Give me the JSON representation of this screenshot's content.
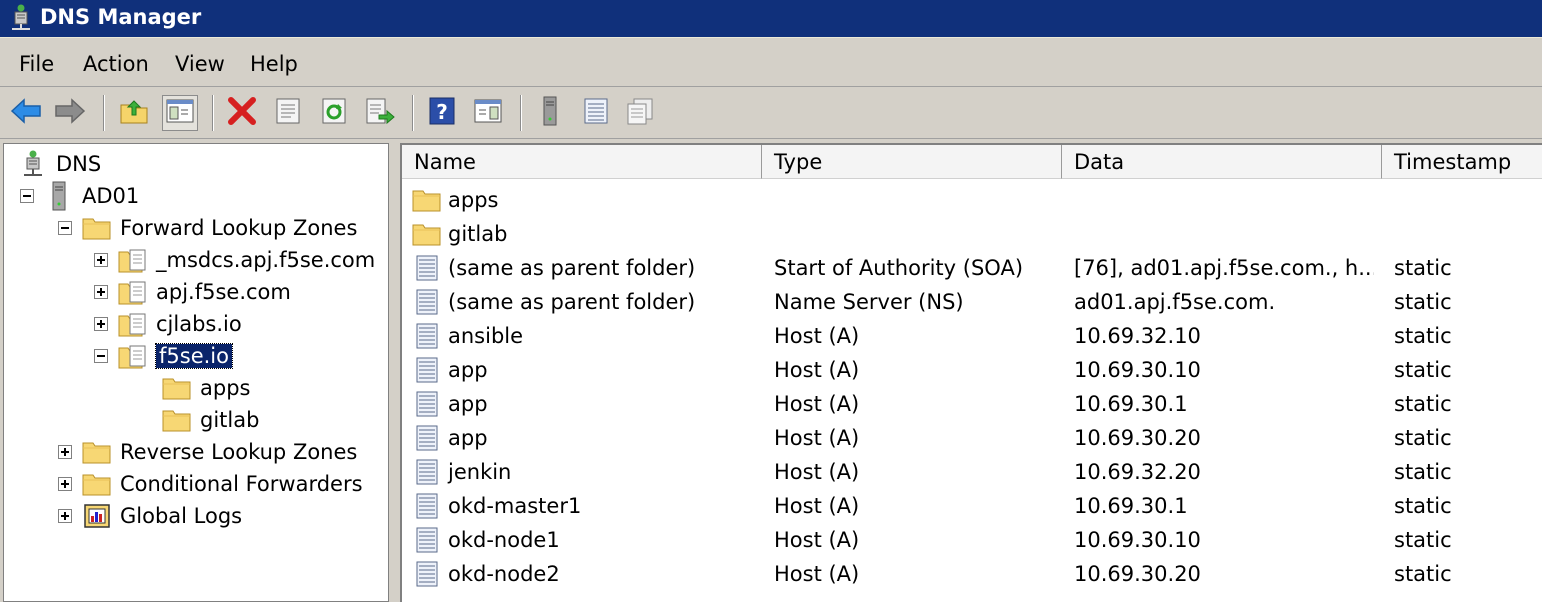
{
  "window": {
    "title": "DNS Manager",
    "icon": "dns-server-icon",
    "title_bar_color": "#10307b"
  },
  "menu": [
    "File",
    "Action",
    "View",
    "Help"
  ],
  "toolbar": [
    {
      "name": "back-button",
      "icon": "arrow-left-icon"
    },
    {
      "name": "forward-button",
      "icon": "arrow-right-icon"
    },
    {
      "name": "up-one-level-button",
      "icon": "folder-up-icon"
    },
    {
      "name": "show-hide-console-tree-button",
      "icon": "console-tree-icon"
    },
    {
      "name": "delete-button",
      "icon": "red-x-icon"
    },
    {
      "name": "properties-button",
      "icon": "properties-icon"
    },
    {
      "name": "refresh-button",
      "icon": "refresh-icon"
    },
    {
      "name": "export-list-button",
      "icon": "export-icon"
    },
    {
      "name": "help-button",
      "icon": "help-icon"
    },
    {
      "name": "show-hide-action-pane-button",
      "icon": "action-pane-icon"
    },
    {
      "name": "server-button",
      "icon": "server-icon"
    },
    {
      "name": "record-button",
      "icon": "record-icon"
    },
    {
      "name": "copy-record-button",
      "icon": "records-icon"
    }
  ],
  "tree": [
    {
      "label": "DNS",
      "icon": "dns-root-icon",
      "expander": "none"
    },
    {
      "label": "AD01",
      "icon": "server-icon",
      "expander": "minus"
    },
    {
      "label": "Forward Lookup Zones",
      "icon": "folder-icon",
      "expander": "minus"
    },
    {
      "label": "_msdcs.apj.f5se.com",
      "icon": "zone-icon",
      "expander": "plus"
    },
    {
      "label": "apj.f5se.com",
      "icon": "zone-icon",
      "expander": "plus"
    },
    {
      "label": "cjlabs.io",
      "icon": "zone-icon",
      "expander": "plus"
    },
    {
      "label": "f5se.io",
      "icon": "zone-icon",
      "expander": "minus",
      "selected": true
    },
    {
      "label": "apps",
      "icon": "folder-icon",
      "expander": "none"
    },
    {
      "label": "gitlab",
      "icon": "folder-icon",
      "expander": "none"
    },
    {
      "label": "Reverse Lookup Zones",
      "icon": "folder-icon",
      "expander": "plus"
    },
    {
      "label": "Conditional Forwarders",
      "icon": "folder-icon",
      "expander": "plus"
    },
    {
      "label": "Global Logs",
      "icon": "log-icon",
      "expander": "plus"
    }
  ],
  "columns": [
    "Name",
    "Type",
    "Data",
    "Timestamp"
  ],
  "records": [
    {
      "name": "apps",
      "type": "",
      "data": "",
      "timestamp": "",
      "icon": "folder-icon"
    },
    {
      "name": "gitlab",
      "type": "",
      "data": "",
      "timestamp": "",
      "icon": "folder-icon"
    },
    {
      "name": "(same as parent folder)",
      "type": "Start of Authority (SOA)",
      "data": "[76], ad01.apj.f5se.com., h...",
      "timestamp": "static",
      "icon": "record-icon"
    },
    {
      "name": "(same as parent folder)",
      "type": "Name Server (NS)",
      "data": "ad01.apj.f5se.com.",
      "timestamp": "static",
      "icon": "record-icon"
    },
    {
      "name": "ansible",
      "type": "Host (A)",
      "data": "10.69.32.10",
      "timestamp": "static",
      "icon": "record-icon"
    },
    {
      "name": "app",
      "type": "Host (A)",
      "data": "10.69.30.10",
      "timestamp": "static",
      "icon": "record-icon"
    },
    {
      "name": "app",
      "type": "Host (A)",
      "data": "10.69.30.1",
      "timestamp": "static",
      "icon": "record-icon"
    },
    {
      "name": "app",
      "type": "Host (A)",
      "data": "10.69.30.20",
      "timestamp": "static",
      "icon": "record-icon"
    },
    {
      "name": "jenkin",
      "type": "Host (A)",
      "data": "10.69.32.20",
      "timestamp": "static",
      "icon": "record-icon"
    },
    {
      "name": "okd-master1",
      "type": "Host (A)",
      "data": "10.69.30.1",
      "timestamp": "static",
      "icon": "record-icon"
    },
    {
      "name": "okd-node1",
      "type": "Host (A)",
      "data": "10.69.30.10",
      "timestamp": "static",
      "icon": "record-icon"
    },
    {
      "name": "okd-node2",
      "type": "Host (A)",
      "data": "10.69.30.20",
      "timestamp": "static",
      "icon": "record-icon"
    }
  ]
}
